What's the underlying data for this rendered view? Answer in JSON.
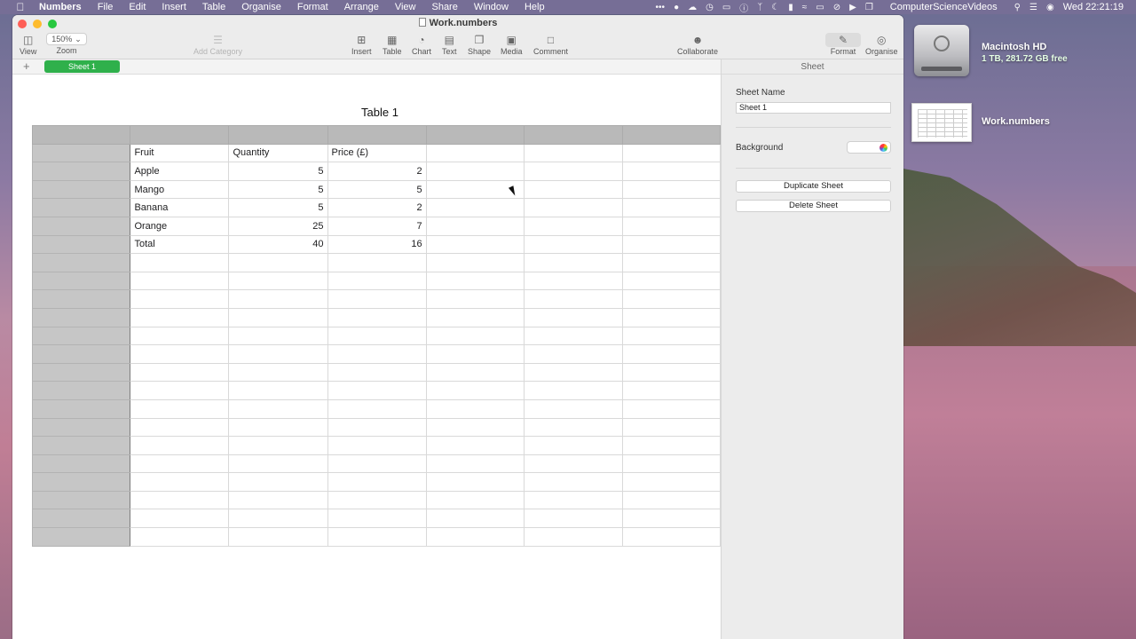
{
  "menubar": {
    "app_name": "Numbers",
    "items": [
      "File",
      "Edit",
      "Insert",
      "Table",
      "Organise",
      "Format",
      "Arrange",
      "View",
      "Share",
      "Window",
      "Help"
    ],
    "user": "ComputerScienceVideos",
    "clock": "Wed  22:21:19"
  },
  "window": {
    "doc_title": "Work.numbers"
  },
  "toolbar": {
    "view_label": "View",
    "zoom_value": "150%",
    "zoom_label": "Zoom",
    "add_category_label": "Add Category",
    "insert_label": "Insert",
    "table_label": "Table",
    "chart_label": "Chart",
    "text_label": "Text",
    "shape_label": "Shape",
    "media_label": "Media",
    "comment_label": "Comment",
    "collaborate_label": "Collaborate",
    "format_label": "Format",
    "organise_label": "Organise"
  },
  "tabs": {
    "add_symbol": "+",
    "sheet_name": "Sheet 1"
  },
  "table": {
    "title": "Table 1",
    "headers": [
      "Fruit",
      "Quantity",
      "Price (£)"
    ],
    "rows": [
      [
        "Apple",
        "5",
        "2"
      ],
      [
        "Mango",
        "5",
        "5"
      ],
      [
        "Banana",
        "5",
        "2"
      ],
      [
        "Orange",
        "25",
        "7"
      ],
      [
        "Total",
        "40",
        "16"
      ]
    ]
  },
  "sidebar": {
    "header": "Sheet",
    "sheet_name_label": "Sheet Name",
    "sheet_name_value": "Sheet 1",
    "background_label": "Background",
    "duplicate_button": "Duplicate Sheet",
    "delete_button": "Delete Sheet"
  },
  "desktop": {
    "drive_name": "Macintosh HD",
    "drive_info": "1 TB, 281.72 GB free",
    "file_name": "Work.numbers"
  }
}
